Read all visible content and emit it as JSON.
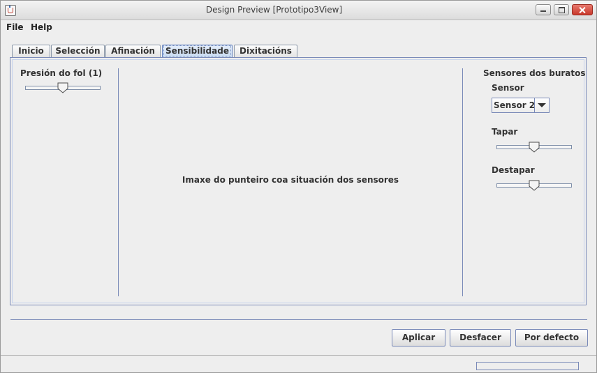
{
  "window": {
    "title": "Design Preview [Prototipo3View]"
  },
  "menubar": {
    "items": [
      "File",
      "Help"
    ]
  },
  "tabs": [
    {
      "label": "Inicio",
      "selected": false
    },
    {
      "label": "Selección",
      "selected": false
    },
    {
      "label": "Afinación",
      "selected": false
    },
    {
      "label": "Sensibilidade",
      "selected": true
    },
    {
      "label": "Dixitacións",
      "selected": false
    }
  ],
  "left_panel": {
    "title": "Presión do fol (1)",
    "slider_value": 0.5
  },
  "center": {
    "placeholder": "Imaxe do punteiro coa situación dos sensores"
  },
  "right_panel": {
    "title": "Sensores dos buratos",
    "sensor_label": "Sensor",
    "sensor_selected": "Sensor 2",
    "tapar_label": "Tapar",
    "tapar_value": 0.5,
    "destapar_label": "Destapar",
    "destapar_value": 0.5
  },
  "buttons": {
    "apply": "Aplicar",
    "undo": "Desfacer",
    "default": "Por defecto"
  },
  "status": {
    "progress": 0
  },
  "colors": {
    "border_accent": "#7a8ab8",
    "selected_tab": "#c8daf1",
    "close_button": "#c8382b"
  }
}
